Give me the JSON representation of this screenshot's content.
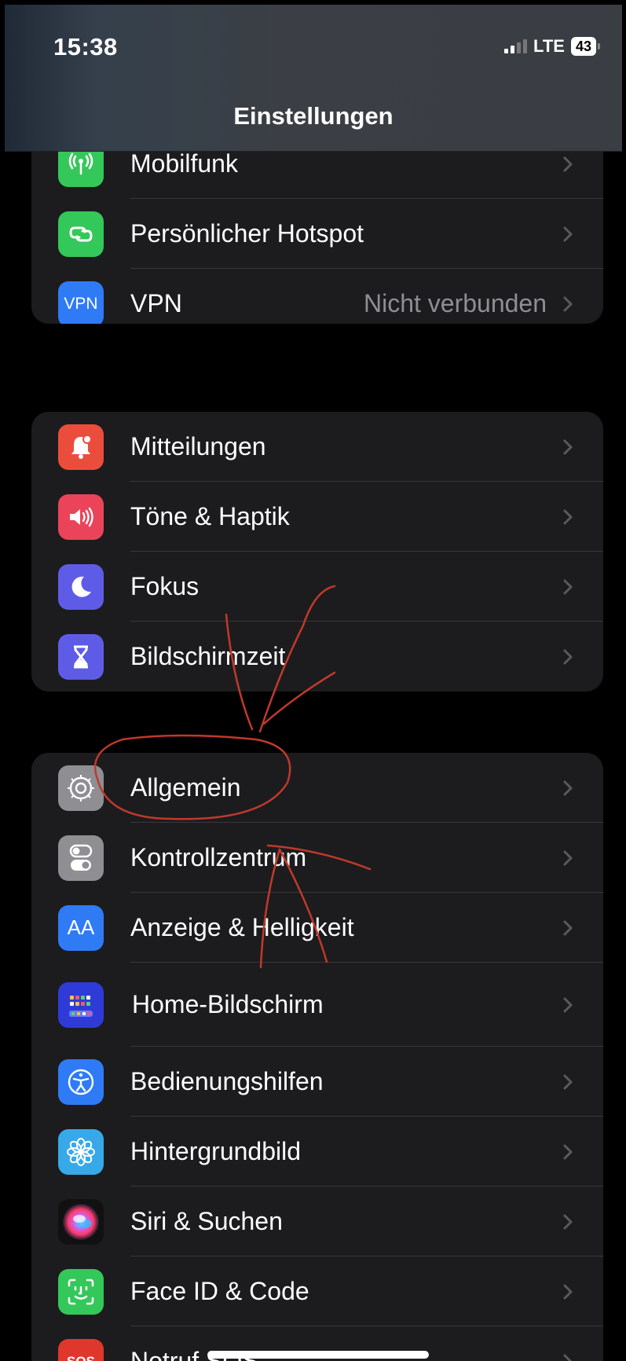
{
  "status_bar": {
    "time": "15:38",
    "network": "LTE",
    "battery": "43"
  },
  "nav": {
    "title": "Einstellungen"
  },
  "groups": [
    {
      "rows": [
        {
          "icon": "antenna-icon",
          "color": "#34c759",
          "label": "Mobilfunk",
          "value": ""
        },
        {
          "icon": "link-icon",
          "color": "#34c759",
          "label": "Persönlicher Hotspot",
          "value": ""
        },
        {
          "icon": "vpn-icon",
          "color": "#2f7bf6",
          "label": "VPN",
          "value": "Nicht verbunden",
          "icon_text": "VPN"
        }
      ]
    },
    {
      "rows": [
        {
          "icon": "bell-icon",
          "color": "#eb4d3d",
          "label": "Mitteilungen"
        },
        {
          "icon": "speaker-icon",
          "color": "#eb445a",
          "label": "Töne & Haptik"
        },
        {
          "icon": "moon-icon",
          "color": "#5e5ce6",
          "label": "Fokus"
        },
        {
          "icon": "hourglass-icon",
          "color": "#5e5ce6",
          "label": "Bildschirmzeit"
        }
      ]
    },
    {
      "rows": [
        {
          "icon": "gear-icon",
          "color": "#8e8e93",
          "label": "Allgemein"
        },
        {
          "icon": "toggle-icon",
          "color": "#8e8e93",
          "label": "Kontrollzentrum"
        },
        {
          "icon": "text-size-icon",
          "color": "#2f7bf6",
          "label": "Anzeige & Helligkeit",
          "icon_text": "AA"
        },
        {
          "icon": "home-grid-icon",
          "color": "#2f3bd9",
          "label": "Home-Bildschirm"
        },
        {
          "icon": "accessibility-icon",
          "color": "#2f7bf6",
          "label": "Bedienungshilfen"
        },
        {
          "icon": "flower-icon",
          "color": "#37a9e8",
          "label": "Hintergrundbild"
        },
        {
          "icon": "siri-icon",
          "color": "#1b1b2e",
          "label": "Siri & Suchen"
        },
        {
          "icon": "face-id-icon",
          "color": "#34c759",
          "label": "Face ID & Code"
        },
        {
          "icon": "sos-icon",
          "color": "#e0372c",
          "label": "Notruf SOS",
          "icon_text": "SOS"
        }
      ]
    }
  ],
  "annotation_color": "#c0392b"
}
